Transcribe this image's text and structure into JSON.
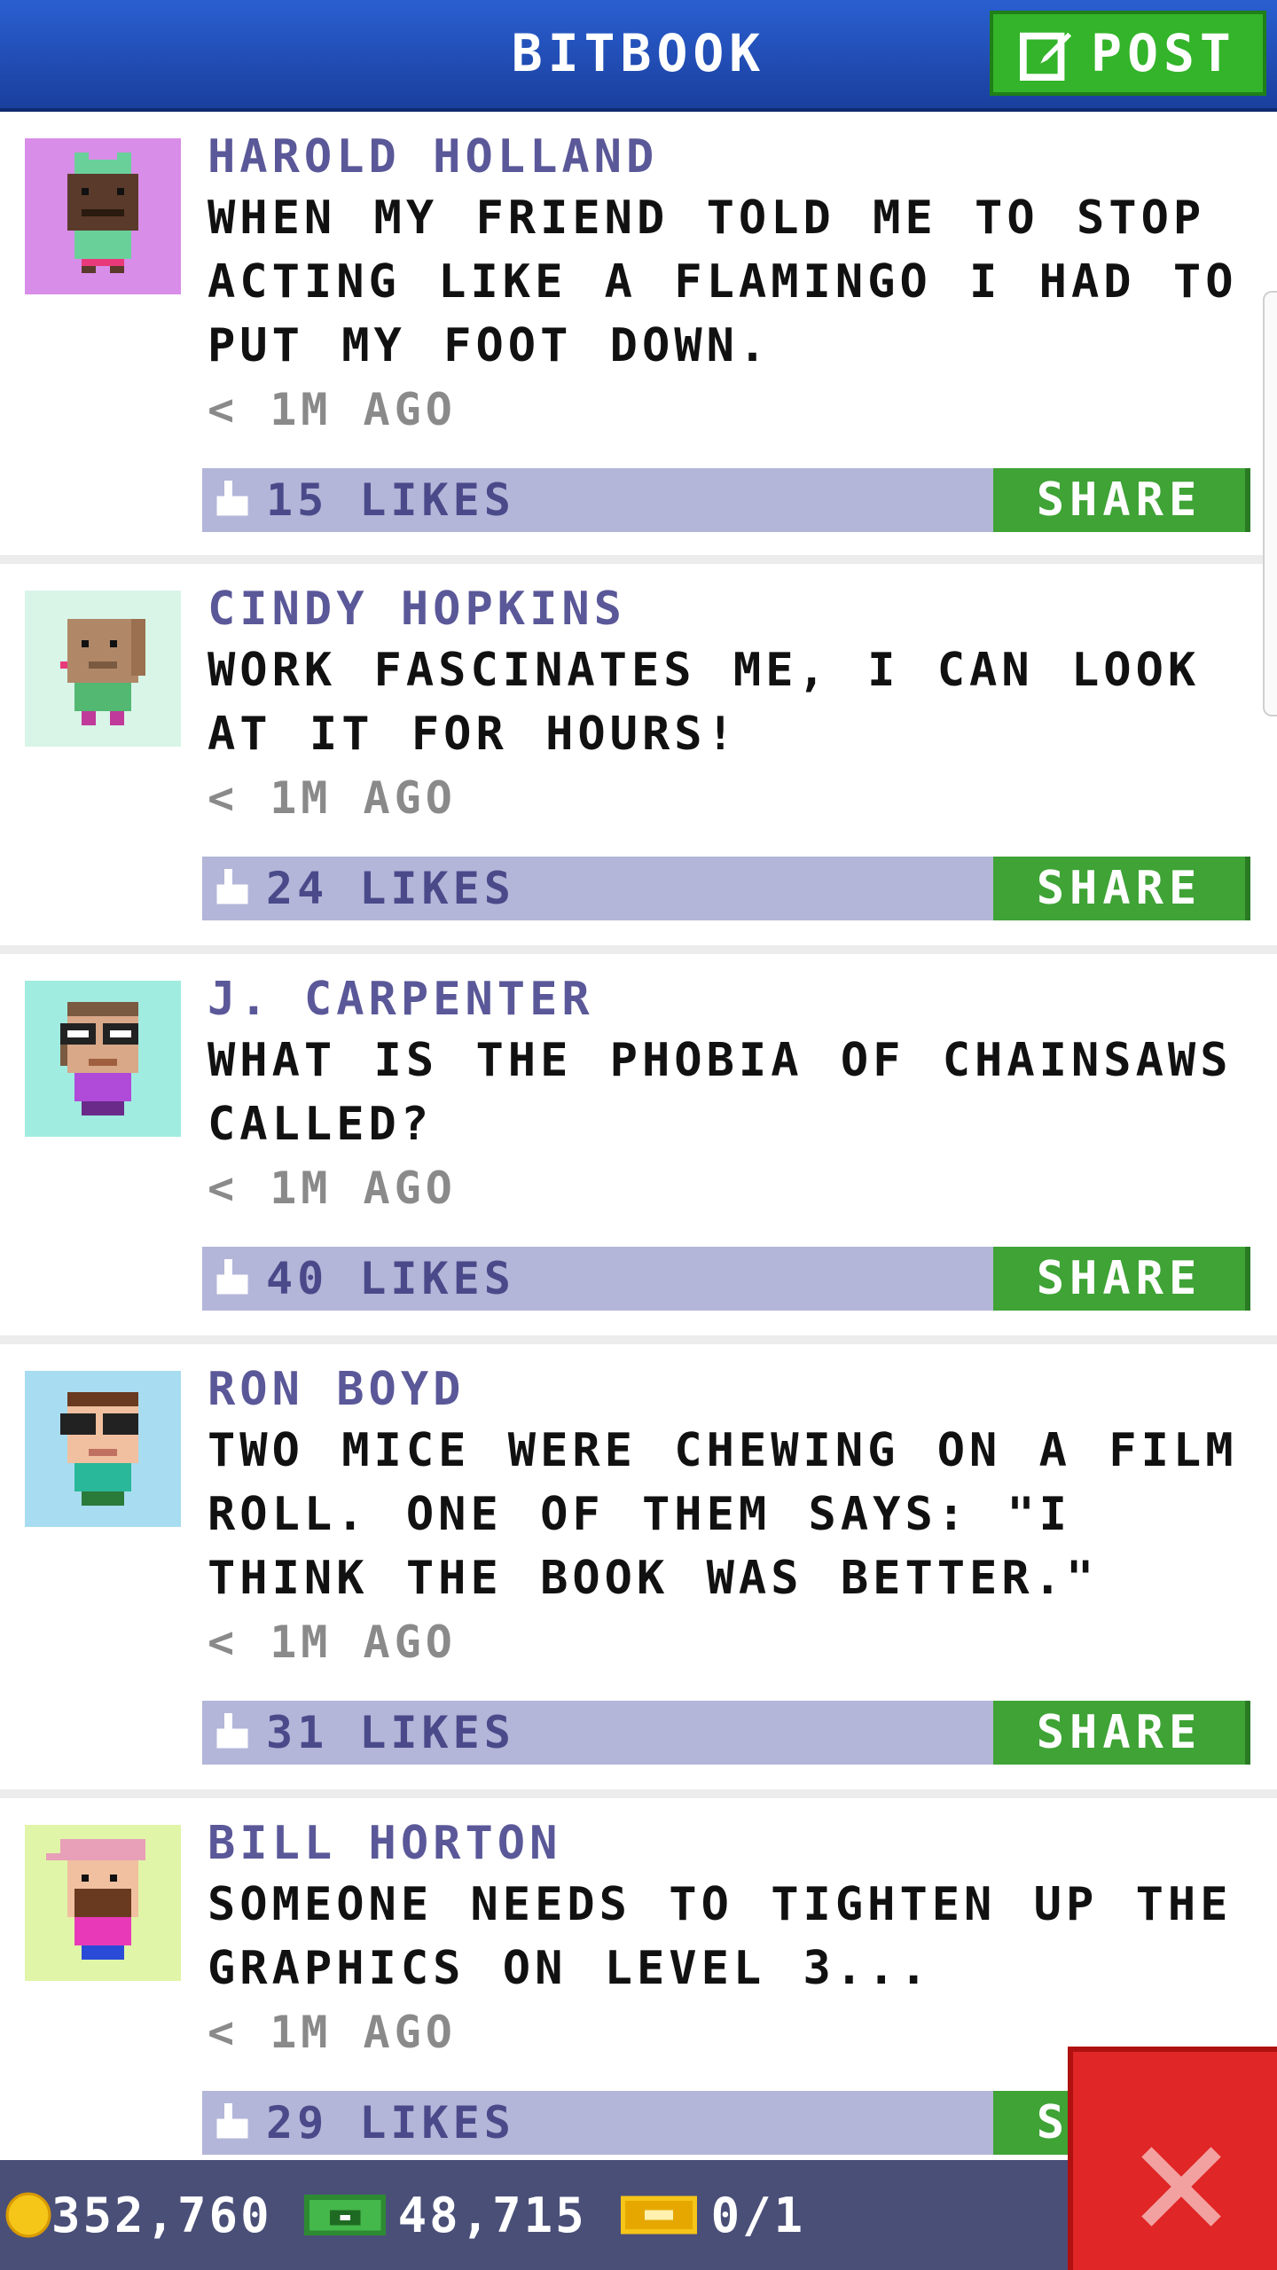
{
  "header": {
    "title": "BITBOOK",
    "post_label": "POST"
  },
  "posts": [
    {
      "author": "HAROLD HOLLAND",
      "message": "WHEN MY FRIEND TOLD ME TO STOP ACTING LIKE A FLAMINGO I HAD TO PUT MY FOOT DOWN.",
      "time": "< 1M AGO",
      "likes": "15 LIKES",
      "share": "SHARE",
      "avatar_bg": "#d88de8"
    },
    {
      "author": "CINDY HOPKINS",
      "message": "WORK FASCINATES ME, I CAN LOOK AT IT FOR HOURS!",
      "time": "< 1M AGO",
      "likes": "24 LIKES",
      "share": "SHARE",
      "avatar_bg": "#d8f5e8"
    },
    {
      "author": "J. CARPENTER",
      "message": "WHAT IS THE PHOBIA OF CHAINSAWS CALLED?",
      "time": "< 1M AGO",
      "likes": "40 LIKES",
      "share": "SHARE",
      "avatar_bg": "#a0ece0"
    },
    {
      "author": "RON BOYD",
      "message": "TWO MICE WERE CHEWING ON A FILM ROLL. ONE OF THEM SAYS: \"I THINK THE BOOK WAS BETTER.\"",
      "time": "< 1M AGO",
      "likes": "31 LIKES",
      "share": "SHARE",
      "avatar_bg": "#a8dcf0"
    },
    {
      "author": "BILL HORTON",
      "message": "SOMEONE NEEDS TO TIGHTEN UP THE GRAPHICS ON LEVEL 3...",
      "time": "< 1M AGO",
      "likes": "29 LIKES",
      "share": "SHARE",
      "avatar_bg": "#e0f5a8"
    }
  ],
  "resources": {
    "coins": "352,760",
    "bux": "48,715",
    "tickets": "0/1"
  },
  "colors": {
    "header": "#2a5fd0",
    "post_button": "#33b42a",
    "share_button": "#3fa336",
    "action_bar": "#b3b6d8",
    "bottom_bar": "#4a4f78",
    "close_button": "#e02626"
  }
}
